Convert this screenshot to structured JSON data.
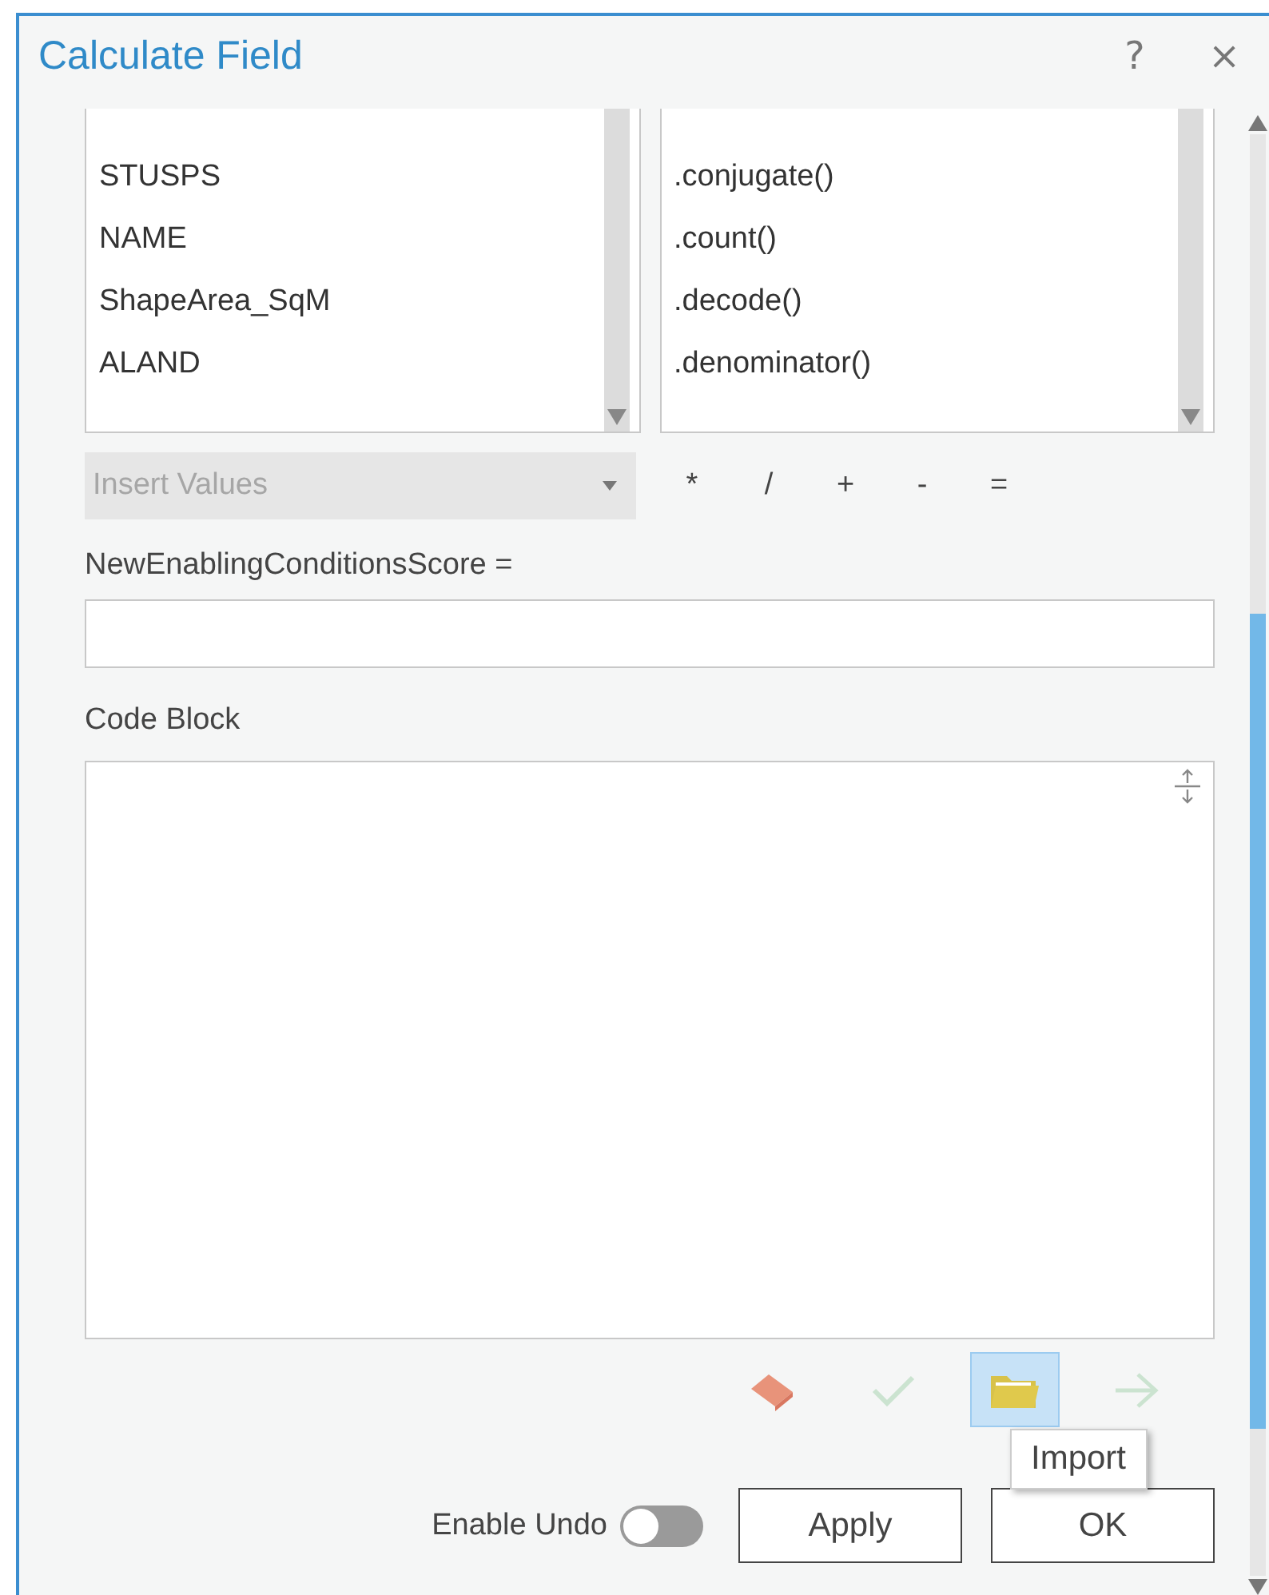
{
  "window": {
    "title": "Calculate Field",
    "help": "?",
    "close": "×"
  },
  "fields": {
    "items": [
      "STUSPS",
      "NAME",
      "ShapeArea_SqM",
      "ALAND"
    ]
  },
  "functions": {
    "items": [
      ".conjugate()",
      ".count()",
      ".decode()",
      ".denominator()"
    ]
  },
  "insert_values": {
    "placeholder": "Insert Values",
    "disabled": true
  },
  "operators": [
    "*",
    "/",
    "+",
    "-",
    "="
  ],
  "expression": {
    "label": "NewEnablingConditionsScore ="
  },
  "code_block": {
    "label": "Code Block"
  },
  "code_tools": [
    {
      "kind": "eraser",
      "selected": false,
      "disabled": false
    },
    {
      "kind": "check",
      "selected": false,
      "disabled": true
    },
    {
      "kind": "folder",
      "selected": true,
      "disabled": false
    },
    {
      "kind": "arrow",
      "selected": false,
      "disabled": true
    }
  ],
  "tooltip": {
    "text": "Import"
  },
  "enable_undo": {
    "label": "Enable Undo",
    "on": false
  },
  "buttons": [
    "Apply",
    "OK"
  ]
}
